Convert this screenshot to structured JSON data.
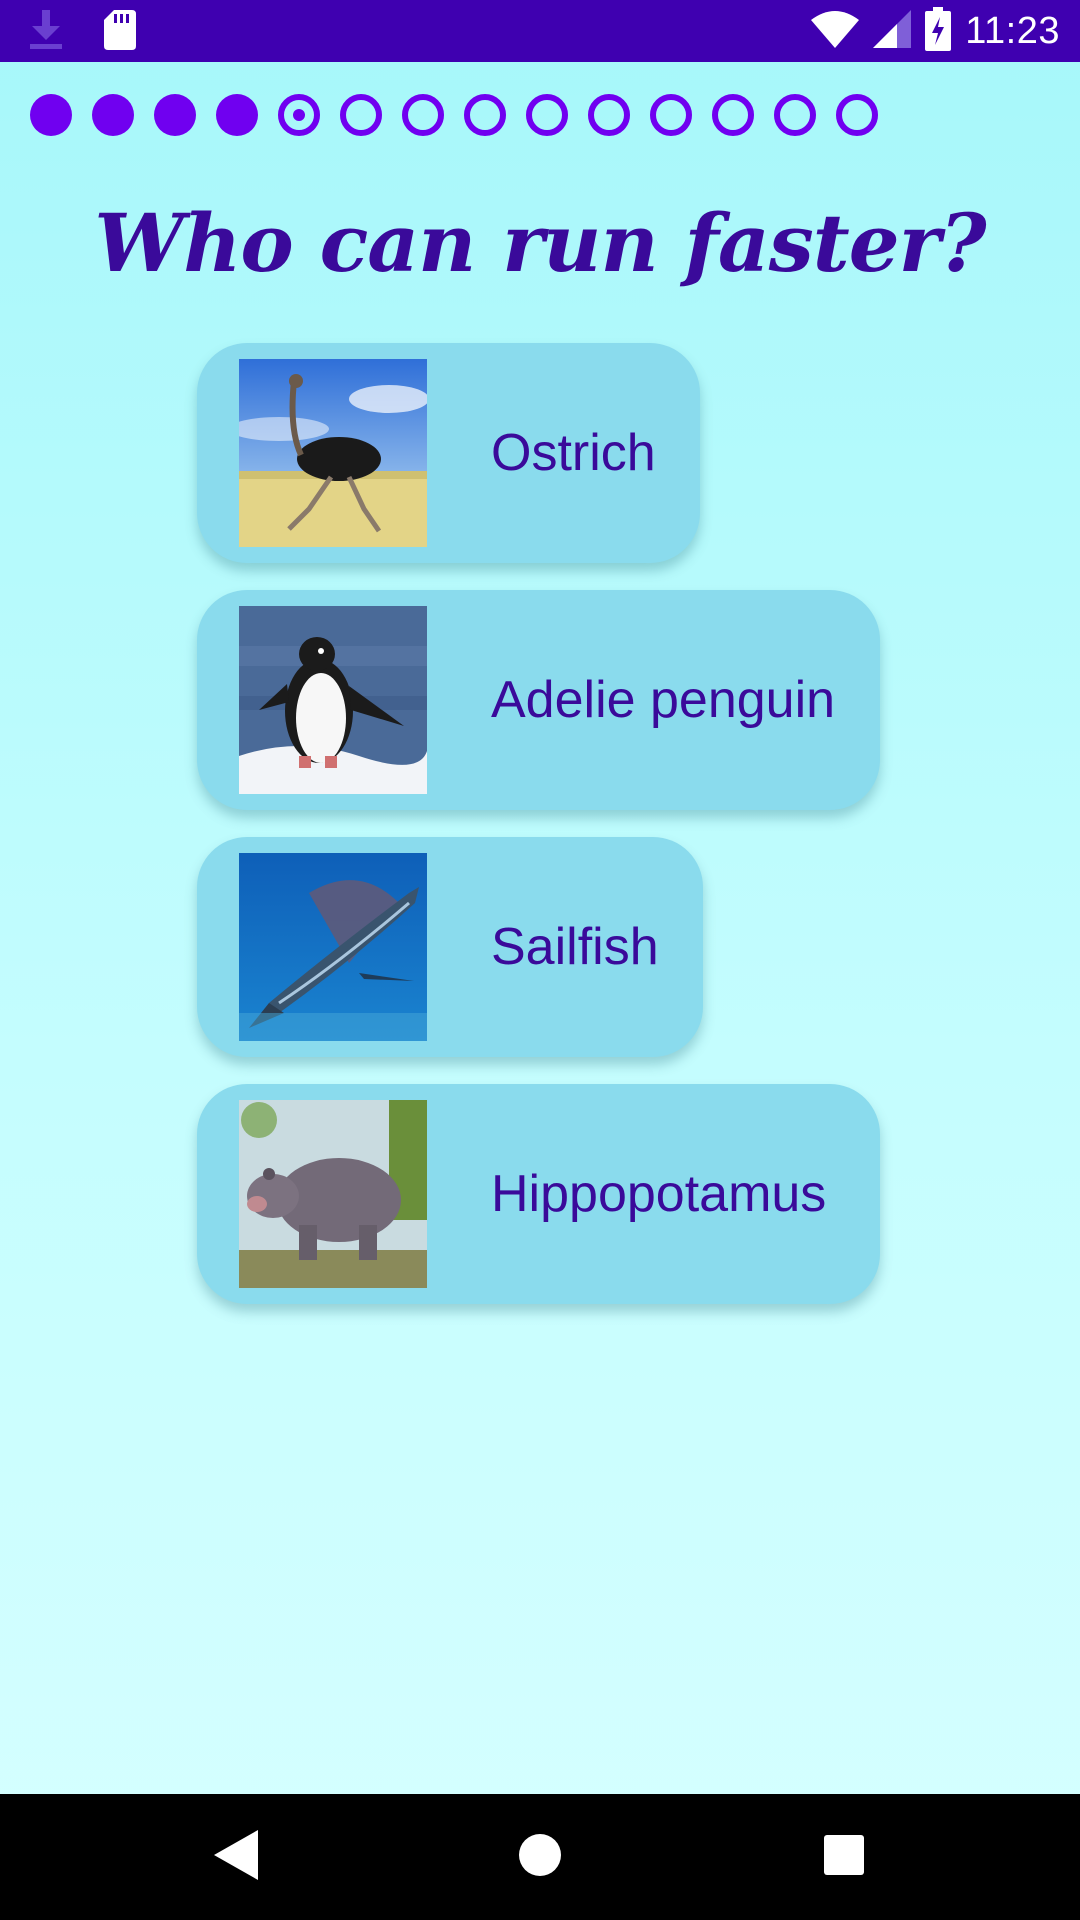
{
  "status_bar": {
    "time": "11:23",
    "icons": [
      "download-icon",
      "sd-card-icon",
      "wifi-icon",
      "cell-signal-icon",
      "battery-charging-icon"
    ]
  },
  "progress": {
    "total": 14,
    "completed": 4,
    "current_index": 5
  },
  "question": {
    "text": "Who can run faster?"
  },
  "answers": [
    {
      "label": "Ostrich",
      "image": "ostrich-image"
    },
    {
      "label": "Adelie penguin",
      "image": "penguin-image"
    },
    {
      "label": "Sailfish",
      "image": "sailfish-image"
    },
    {
      "label": "Hippopotamus",
      "image": "hippopotamus-image"
    }
  ],
  "nav_bar": {
    "icons": [
      "back-icon",
      "home-icon",
      "recents-icon"
    ]
  },
  "colors": {
    "accent": "#7000f0",
    "text": "#3a0a9a",
    "card": "#8adbed",
    "status_bar": "#3f00b0"
  }
}
